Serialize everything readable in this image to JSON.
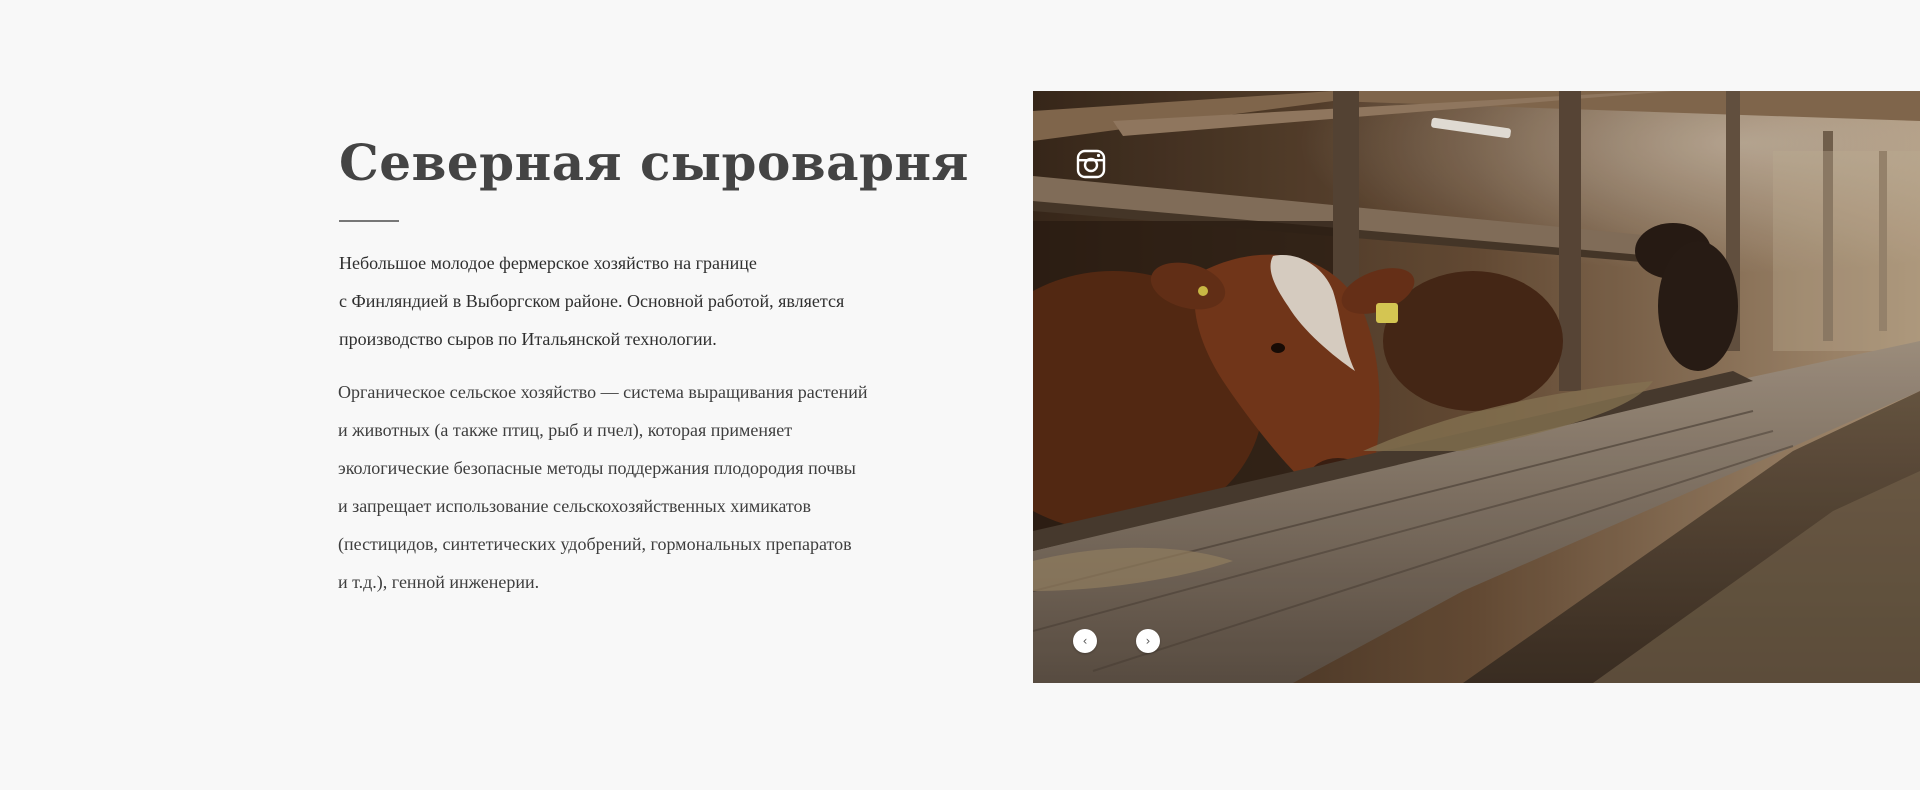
{
  "section": {
    "title": "Северная сыроварня",
    "intro_lines": [
      "Небольшое молодое фермерское хозяйство на границе",
      "с Финляндией  в Выборгском  районе. Основной работой, является",
      "производство сыров по Итальянской технологии."
    ],
    "organic_lines": [
      "Органическое сельское хозяйство — система выращивания растений",
      "и животных (а также птиц, рыб и пчел), которая применяет",
      "экологические безопасные методы поддержания плодородия почвы",
      "и запрещает использование сельскохозяйственных химикатов",
      "(пестицидов, синтетических удобрений, гормональных препаратов",
      "и т.д.), генной инженерии."
    ]
  },
  "slider": {
    "social_icon": "instagram-icon",
    "prev_icon": "chevron-left-icon",
    "next_icon": "chevron-right-icon",
    "prev_glyph": "‹",
    "next_glyph": "›"
  }
}
